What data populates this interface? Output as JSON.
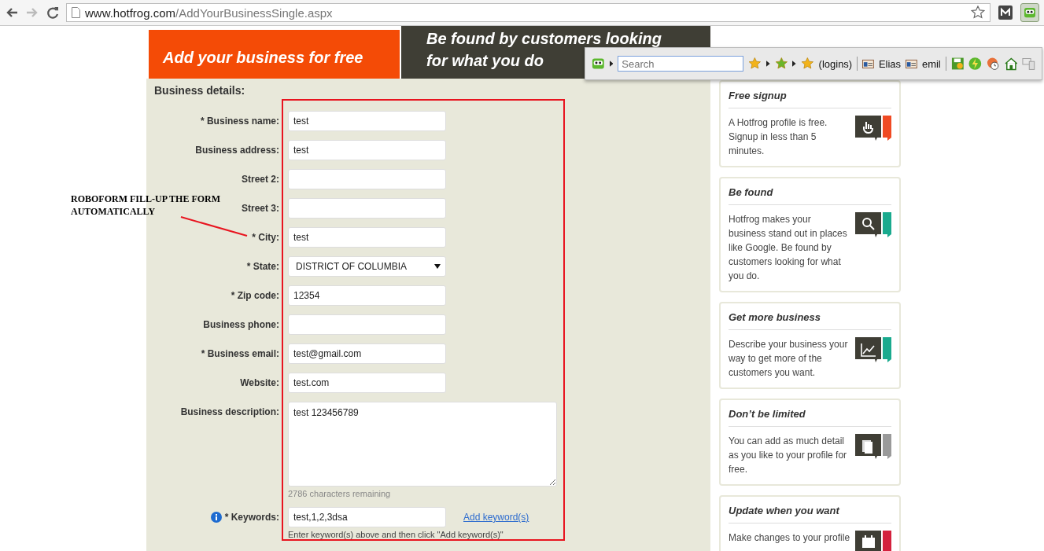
{
  "browser": {
    "url_host": "www.hotfrog.com",
    "url_path": "/AddYourBusinessSingle.aspx"
  },
  "roboform": {
    "search": {
      "placeholder": "Search"
    },
    "items": [
      {
        "kind": "logins",
        "label": "(logins)"
      },
      {
        "kind": "identity",
        "label": "Elias"
      },
      {
        "kind": "identity",
        "label": "emil"
      }
    ]
  },
  "header": {
    "tabs": [
      {
        "label": "Add your business for free",
        "selected": true
      },
      {
        "label": "Be found by customers looking for what you do",
        "selected": false
      }
    ]
  },
  "form": {
    "title": "Business details:",
    "fields": [
      {
        "kind": "text",
        "label": "* Business name:",
        "value": "test"
      },
      {
        "kind": "text",
        "label": "Business address:",
        "value": "test"
      },
      {
        "kind": "text",
        "label": "Street 2:"
      },
      {
        "kind": "text",
        "label": "Street 3:"
      },
      {
        "kind": "text",
        "label": "* City:",
        "value": "test"
      },
      {
        "kind": "select",
        "label": "* State:",
        "value": "DISTRICT OF COLUMBIA"
      },
      {
        "kind": "text",
        "label": "* Zip code:",
        "value": "12354"
      },
      {
        "kind": "text",
        "label": "Business phone:"
      },
      {
        "kind": "text",
        "label": "* Business email:",
        "value": "test@gmail.com"
      },
      {
        "kind": "text",
        "label": "Website:",
        "value": "test.com"
      },
      {
        "kind": "textarea",
        "label": "Business description:",
        "value": "test 123456789",
        "note": "2786 characters remaining"
      },
      {
        "kind": "keywords",
        "label": "* Keywords:",
        "value": "test,1,2,3dsa",
        "link": "Add keyword(s)",
        "hint": "Enter keyword(s) above and then click \"Add keyword(s)\""
      }
    ]
  },
  "annotation": {
    "text": "ROBOFORM FILL-UP THE FORM AUTOMATICALLY"
  },
  "sidebar": {
    "cards": [
      {
        "title": "Free signup",
        "text": "A Hotfrog profile is free. Signup in less than 5 minutes.",
        "kind": "hand",
        "color": "#f04a23"
      },
      {
        "title": "Be found",
        "text": "Hotfrog makes your business stand out in places like Google. Be found by customers looking for what you do.",
        "kind": "search",
        "color": "#1aaa8e"
      },
      {
        "title": "Get more business",
        "text": "Describe your business your way to get more of the customers you want.",
        "kind": "chart",
        "color": "#1aaa8e"
      },
      {
        "title": "Don’t be limited",
        "text": "You can add as much detail as you like to your profile for free.",
        "kind": "document",
        "color": "#9a9a9a"
      },
      {
        "title": "Update when you want",
        "text": "Make changes to your profile",
        "kind": "calendar",
        "color": "#d4213d"
      }
    ]
  }
}
